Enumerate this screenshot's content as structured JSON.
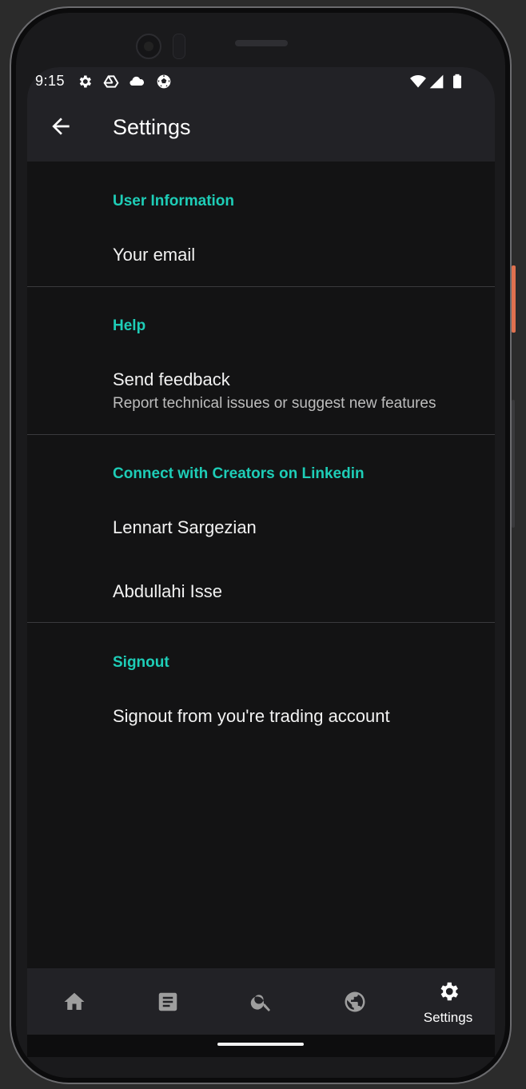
{
  "status_bar": {
    "time": "9:15",
    "left_icons": [
      "gear-icon",
      "drive-icon",
      "cloud-icon",
      "soccer-ball-icon"
    ],
    "right_icons": [
      "wifi-icon",
      "signal-icon",
      "battery-icon"
    ]
  },
  "app_bar": {
    "title": "Settings",
    "back_icon": "arrow-back-icon"
  },
  "sections": [
    {
      "header": "User Information",
      "items": [
        {
          "title": "Your email"
        }
      ]
    },
    {
      "header": "Help",
      "items": [
        {
          "title": "Send feedback",
          "subtitle": "Report technical issues or suggest new features"
        }
      ]
    },
    {
      "header": "Connect with Creators on Linkedin",
      "items": [
        {
          "title": "Lennart Sargezian"
        },
        {
          "title": "Abdullahi Isse"
        }
      ]
    },
    {
      "header": "Signout",
      "items": [
        {
          "title": "Signout from you're trading account"
        }
      ]
    }
  ],
  "bottom_nav": {
    "items": [
      {
        "icon": "home-icon"
      },
      {
        "icon": "article-icon"
      },
      {
        "icon": "search-icon"
      },
      {
        "icon": "globe-icon"
      },
      {
        "icon": "settings-icon",
        "label": "Settings",
        "active": true
      }
    ]
  },
  "colors": {
    "background": "#131314",
    "app_bar": "#222226",
    "accent": "#1ecdb7",
    "text": "#f2f2f2",
    "inactive_icon": "#9e9e9e"
  }
}
